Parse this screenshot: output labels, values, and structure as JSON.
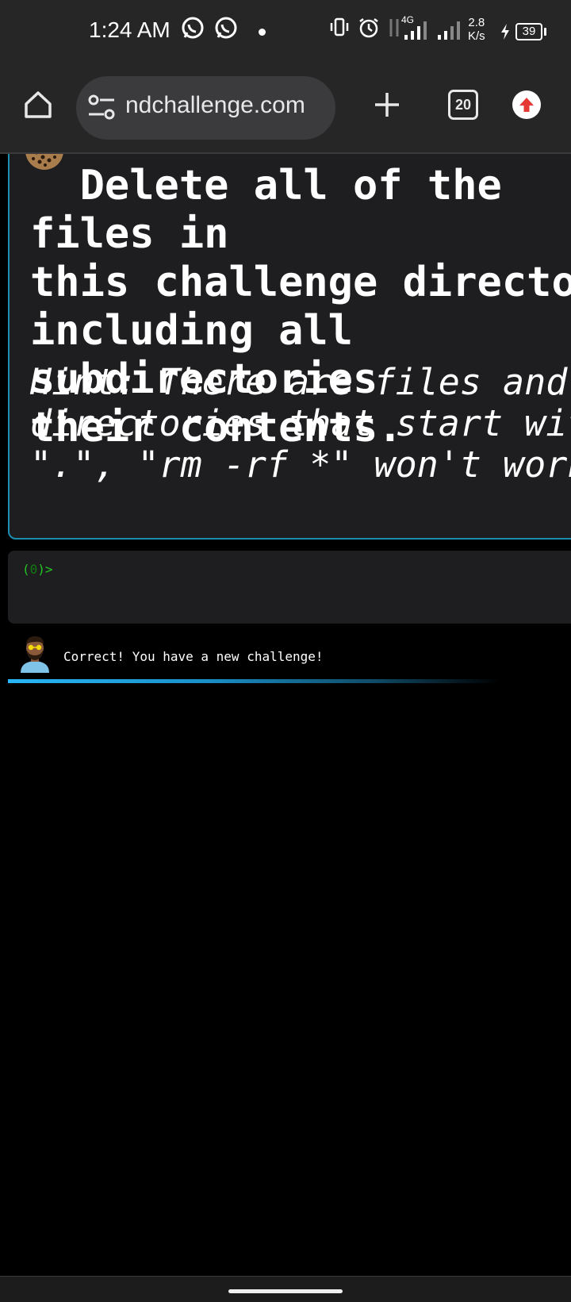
{
  "status_bar": {
    "time": "1:24 AM",
    "network_type": "4G",
    "speed_value": "2.8",
    "speed_unit": "K/s",
    "battery_level": "39",
    "icons": [
      "whatsapp-icon",
      "whatsapp-icon",
      "vibrate-icon",
      "alarm-icon",
      "data-arrows-icon",
      "signal-icon",
      "signal-icon",
      "charging-icon"
    ]
  },
  "browser": {
    "url": "ndchallenge.com",
    "tab_count": "20",
    "icons": [
      "home-icon",
      "site-settings-icon",
      "new-tab-icon",
      "tab-switcher-icon",
      "update-icon"
    ]
  },
  "challenge": {
    "title": "  Delete all of the files in\nthis challenge directory\nincluding all subdirectories\ntheir contents.",
    "hint": "Hint: There are files and\ndirectories that start with\n\".\", \"rm -rf *\" won't work"
  },
  "terminal": {
    "prompt_open": "(",
    "prompt_count": "0",
    "prompt_close": ")>"
  },
  "feedback": {
    "message": "Correct! You have a new challenge!"
  },
  "colors": {
    "accent": "#1c8fb0",
    "progress": "#29b6f6",
    "prompt": "#22c622",
    "panel": "#1e1e20",
    "toolbar": "#262627"
  }
}
